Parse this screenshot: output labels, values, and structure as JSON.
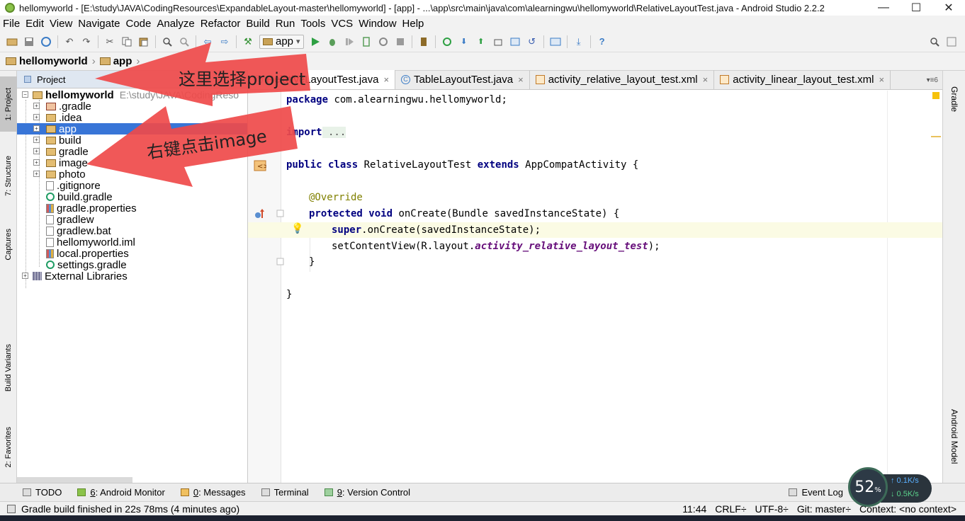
{
  "window": {
    "title": "hellomyworld - [E:\\study\\JAVA\\CodingResources\\ExpandableLayout-master\\hellomyworld] - [app] - ...\\app\\src\\main\\java\\com\\alearningwu\\hellomyworld\\RelativeLayoutTest.java - Android Studio 2.2.2",
    "minimize": "—",
    "maximize": "☐",
    "close": "✕"
  },
  "menu": [
    "File",
    "Edit",
    "View",
    "Navigate",
    "Code",
    "Analyze",
    "Refactor",
    "Build",
    "Run",
    "Tools",
    "VCS",
    "Window",
    "Help"
  ],
  "toolbar": {
    "run_config": "app",
    "dropdown_arrow": "▾"
  },
  "navbar": {
    "crumbs": [
      "hellomyworld",
      "app"
    ],
    "separator": "›"
  },
  "left_stripe": {
    "tabs": [
      "1: Project",
      "7: Structure",
      "Captures",
      "Build Variants",
      "2: Favorites"
    ]
  },
  "right_stripe": {
    "tabs": [
      "Gradle",
      "Android Model"
    ]
  },
  "project_panel": {
    "header": "Project",
    "root": {
      "name": "hellomyworld",
      "path": "E:\\study\\JAVA\\CodingReso"
    },
    "items": [
      ".gradle",
      ".idea",
      "app",
      "build",
      "gradle",
      "image",
      "photo",
      ".gitignore",
      "build.gradle",
      "gradle.properties",
      "gradlew",
      "gradlew.bat",
      "hellomyworld.iml",
      "local.properties",
      "settings.gradle"
    ],
    "external": "External Libraries",
    "expand_plus": "+",
    "expand_minus": "−"
  },
  "editor": {
    "tabs": [
      {
        "label": "RelativeLayoutTest.java",
        "close": "×"
      },
      {
        "label": "TableLayoutTest.java",
        "close": "×"
      },
      {
        "label": "activity_relative_layout_test.xml",
        "close": "×"
      },
      {
        "label": "activity_linear_layout_test.xml",
        "close": "×"
      }
    ],
    "tab_menu": "▾≡6",
    "code": {
      "package_kw": "package",
      "package_name": " com.alearningwu.hellomyworld;",
      "import_kw": "import",
      "import_fold": " ...",
      "class_line": {
        "mods": "public class",
        "name": " RelativeLayoutTest ",
        "extends_kw": "extends",
        "parent": " AppCompatActivity {"
      },
      "override": "@Override",
      "method_line": {
        "mods": "protected void",
        "rest": " onCreate(Bundle savedInstanceState) {"
      },
      "super_line": {
        "kw": "super",
        "rest": ".onCreate(savedInstanceState);"
      },
      "content_line": {
        "pre": "setContentView(R.layout.",
        "field": "activity_relative_layout_test",
        "post": ");"
      },
      "close_method": "}",
      "close_class": "}"
    }
  },
  "annotations": {
    "arrow1": "这里选择project",
    "arrow2": "右键点击image",
    "color": "#ef4a4a"
  },
  "bottom_tools": [
    {
      "prefix": "",
      "label": "TODO"
    },
    {
      "prefix": "6",
      "label": ": Android Monitor"
    },
    {
      "prefix": "0",
      "label": ": Messages"
    },
    {
      "prefix": "",
      "label": "Terminal"
    },
    {
      "prefix": "9",
      "label": ": Version Control"
    }
  ],
  "event_log": "Event Log",
  "status": {
    "message": "Gradle build finished in 22s 78ms (4 minutes ago)",
    "position": "11:44",
    "line_sep": "CRLF÷",
    "encoding": "UTF-8÷",
    "git": "Git: master÷",
    "context": "Context: <no context>"
  },
  "network_widget": {
    "percent": "52",
    "percent_unit": "%",
    "up": "↑ 0.1K/s",
    "down": "↓ 0.5K/s"
  }
}
